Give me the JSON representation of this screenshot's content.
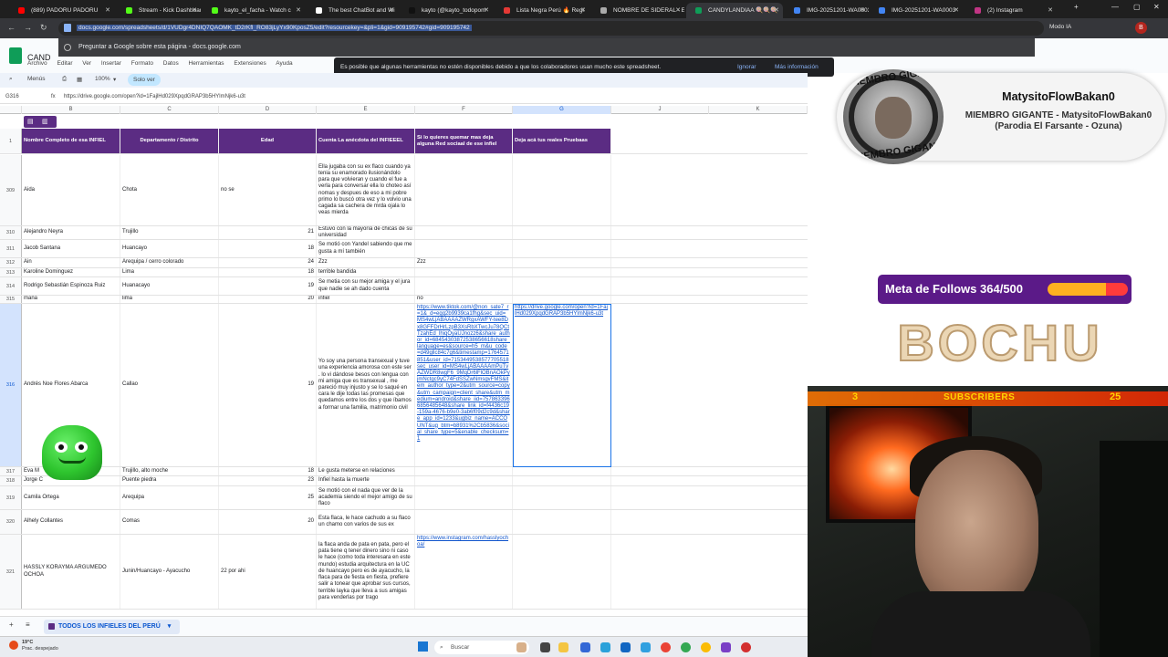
{
  "browser": {
    "tabs": [
      {
        "label": "(889) PADORU PADORU",
        "color": "#ff0000"
      },
      {
        "label": "Stream - Kick Dashboard",
        "color": "#53fc18"
      },
      {
        "label": "kayto_el_facha - Watch c",
        "color": "#53fc18"
      },
      {
        "label": "The best ChatBot and Wi",
        "color": "#ffffff"
      },
      {
        "label": "kayto (@kayto_todopom",
        "color": "#111111"
      },
      {
        "label": "Lista Negra Perú 🔥 Regi",
        "color": "#e53935"
      },
      {
        "label": "NOMBRE DE SIDERAL - E",
        "color": "#aaaaaa"
      },
      {
        "label": "CANDYLANDIAA 🍭🍭🍭",
        "color": "#0f9d58"
      },
      {
        "label": "IMG-20251201-WA0003",
        "color": "#4285f4"
      },
      {
        "label": "IMG-20251201-WA0003",
        "color": "#4285f4"
      },
      {
        "label": "(2) Instagram",
        "color": "#c13584"
      }
    ],
    "url": "docs.google.com/spreadsheets/d/1VUDgr4DNIQ7QAOMK_tD2rKfl_RO83jLyYx90KposZ5/edit?resourcekey=&pli=1&gid=909195742#gid=909195742",
    "modo_ia": "Modo IA",
    "profile_letter": "B",
    "ask_google": "Preguntar a Google sobre esta página - docs.google.com"
  },
  "sheets": {
    "title": "CAND",
    "menu": [
      "Archivo",
      "Editar",
      "Ver",
      "Insertar",
      "Formato",
      "Datos",
      "Herramientas",
      "Extensiones",
      "Ayuda"
    ],
    "notice": "Es posible que algunas herramientas no estén disponibles debido a que los colaboradores usan mucho este spreadsheet.",
    "notice_ignore": "Ignorar",
    "notice_more": "Más información",
    "toolbar": {
      "menus": "Menús",
      "zoom": "100%",
      "view_only": "Solo ver"
    },
    "cell_ref": "G316",
    "formula": "https://drive.google.com/open?id=1FajlHd029XpqdGRAP3b5HYlmNjk6-u3t",
    "columns": [
      "B",
      "C",
      "D",
      "E",
      "F",
      "G",
      "",
      "J",
      "K"
    ],
    "headers": {
      "b": "Nombre Completo de esa INFIEL",
      "c": "Departamento / Distrito",
      "d": "Edad",
      "e": "Cuenta La anécdota del INFIEEEL",
      "f": "Si lo quieres quemar mas deja alguna Red sociaal de ese infiel",
      "g": "Deja acá tus reales Pruebaas"
    },
    "header_row_num": "1",
    "rows": [
      {
        "n": "309",
        "b": "Aida",
        "c": "Chota",
        "d": "no se",
        "e": "Ella jugaba con su ex flaco cuando ya tenia su enamorado ilusionándolo para que volvieran y cuando el fue a verla para conversar ella lo choteo así nomas y despues de eso a mi pobre primo lo buscó otra vez y lo volvio una cagada sa cachera de mrda ojala lo veas mierda",
        "f": "",
        "g": ""
      },
      {
        "n": "310",
        "b": "Alejandro Neyra",
        "c": "Trujillo",
        "d": "21",
        "e": "Estuvo con la mayoría de chicas de su universidad",
        "f": "",
        "g": ""
      },
      {
        "n": "311",
        "b": "Jacob Santana",
        "c": "Huancayo",
        "d": "18",
        "e": "Se motió con Yandel sabiendo que me gusta a mí también",
        "f": "",
        "g": ""
      },
      {
        "n": "312",
        "b": "Ain",
        "c": "Arequipa / cerro colorado",
        "d": "24",
        "e": "Zzz",
        "f": "Zzz",
        "g": ""
      },
      {
        "n": "313",
        "b": "Karoline Dominguez",
        "c": "Lima",
        "d": "18",
        "e": "terrible bandida",
        "f": "",
        "g": ""
      },
      {
        "n": "314",
        "b": "Rodrigo Sebastián Espinoza Ruiz",
        "c": "Huanacayo",
        "d": "19",
        "e": "Se metia con su mejor amiga y el jura que nadie se ah dado cuenta",
        "f": "",
        "g": ""
      },
      {
        "n": "315",
        "b": "mana",
        "c": "lima",
        "d": "20",
        "e": "infiel",
        "f": "no",
        "g": ""
      },
      {
        "n": "316",
        "b": "Andrés Noe Flores Abarca",
        "c": "Callao",
        "d": "19",
        "e": "Yo soy una persona transexual y tuve una experiencia amorosa con este ser . lo vi dándose besos con lengua con mi amiga que es transexual , me pareció muy injusto y se lo saqué en cara le dije todas las promesas que quedamos entre los dos y que íbamos a formar una familia, matrimonio civil",
        "f": "https://www.tiktok.com/@non_sate7_r=1&_d=egg2b9939ca1fhg&sec_uid=MS4wLjABAAAAZWRgxAWFY-tee8Dx8GFFDrHrLzpB3XsRbXTwcJu78QCtTzahEd_lhiqOyaUJnozz6&share_author_id=68454303872538656618share_language=es&source=h5_m&u_code=d49gllc84c7g6&timestamp=1764571851&user_id=7153449538577705518sec_user_id=MS4wLjABAAAAmPuTvAZWDR8wgF6_9MqDr6lFlOBnAOkPyjmNctgc9yC74FdSSZwNmsgvFMS&item_author_type=2&utm_source=copy&utm_campaign=client_share&utm_medium=android&share_iid=7578633966856485648&share_link_id=f4436c19-159a-4676-b9e0-3ab6f09d2c9d&share_app_id=1233&ugbiz_name=ACCOUNT&ug_btm=b8931%2Cb5836&social_share_type=5&enable_checksum=1",
        "g": "https://drive.google.com/open?id=1FajlHd029XpqdGRAP3b5HYlmNjk6-u3t"
      },
      {
        "n": "317",
        "b": "Eva M",
        "c": "Trujillo, alto moche",
        "d": "18",
        "e": "Le gusta meterse en relaciones",
        "f": "",
        "g": ""
      },
      {
        "n": "318",
        "b": "Jorge C",
        "c": "Puente piedra",
        "d": "23",
        "e": "Infiel hasta la muerte",
        "f": "",
        "g": ""
      },
      {
        "n": "319",
        "b": "Camila Ortega",
        "c": "Arequipa",
        "d": "25",
        "e": "Se motió con el nada que ver de la academia siendo el mejor amigo de su flaco",
        "f": "",
        "g": ""
      },
      {
        "n": "320",
        "b": "Alhely Collantes",
        "c": "Comas",
        "d": "20",
        "e": "Esta flaca, le hace cachudo a su flaco un chamo con varios de sus ex",
        "f": "",
        "g": ""
      },
      {
        "n": "321",
        "b": "HASSLY KORAYMA ARGUMEDO OCHOA",
        "c": "Junin/Huancayo - Ayacucho",
        "d": "22 por ahi",
        "e": "la flaca anda de pata en pata, pero el pata tiene q tener dinero sino ni caso le hace (como toda interesara en este mundo) estudia arquitectura en la UC de huancayo pero es de ayacucho, la flaca para de fiesta en fiesta, prefiere salir a tonear que aprobar sus cursos, terrible layka que lleva a sus amigas para venderlas por trago",
        "f": "https://www.instagram.com/hasslyochoa/",
        "g": ""
      }
    ],
    "sheet_tab": "TODOS LOS INFIELES DEL PERÚ"
  },
  "taskbar": {
    "weather_temp": "19°C",
    "weather_desc": "Prac. despejado",
    "search": "Buscar"
  },
  "overlay": {
    "member_name": "MatysitoFlowBakan0",
    "member_role": "MIEMBRO GIGANTE - MatysitoFlowBakan0 (Parodia El Farsante - Ozuna)",
    "member_pic_text_top": "MIEMBRO GIGANTE",
    "member_pic_text_bottom": "MIEMBRO GIGANTE",
    "goal_text": "Meta de Follows 364/500",
    "goal_fraction": 0.728,
    "brand": "BOCHU",
    "subs_current": "3",
    "subs_label": "SUBSCRIBERS",
    "subs_goal": "25"
  }
}
